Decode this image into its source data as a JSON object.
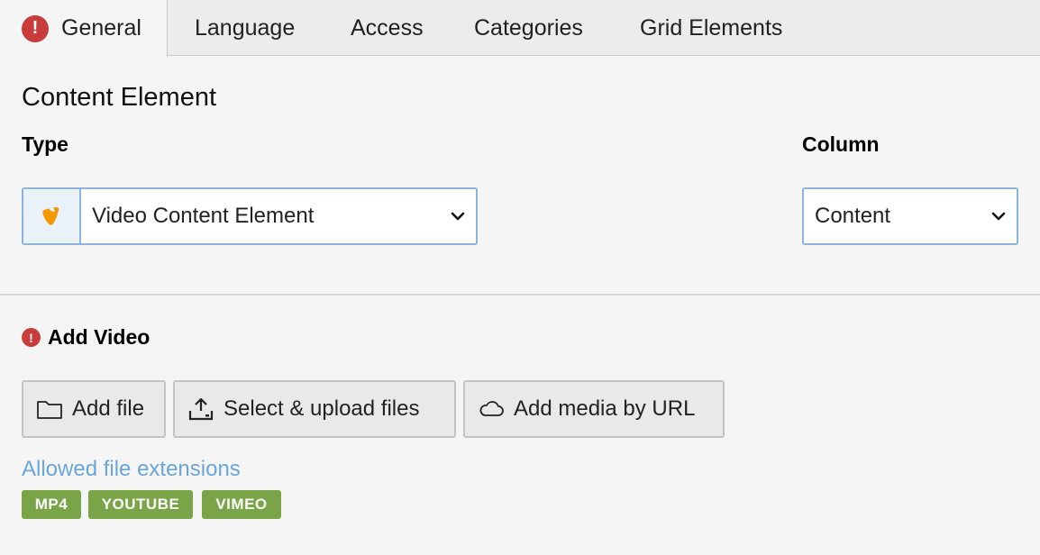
{
  "tabs": [
    {
      "label": "General",
      "active": true,
      "has_error": true
    },
    {
      "label": "Language"
    },
    {
      "label": "Access"
    },
    {
      "label": "Categories"
    },
    {
      "label": "Grid Elements"
    }
  ],
  "section_title": "Content Element",
  "type_field": {
    "label": "Type",
    "value": "Video Content Element",
    "icon": "typo3-logo-icon"
  },
  "column_field": {
    "label": "Column",
    "value": "Content"
  },
  "add_video": {
    "label": "Add Video",
    "buttons": [
      {
        "label": "Add file",
        "icon": "folder-icon"
      },
      {
        "label": "Select & upload files",
        "icon": "upload-icon"
      },
      {
        "label": "Add media by URL",
        "icon": "cloud-icon"
      }
    ],
    "allowed_extensions_label": "Allowed file extensions",
    "extensions": [
      "MP4",
      "YOUTUBE",
      "VIMEO"
    ]
  },
  "colors": {
    "error": "#c83c3c",
    "badge": "#79a548",
    "link": "#6aa6d9",
    "select_border": "#8cb4dc",
    "typo3_orange": "#f49700"
  }
}
